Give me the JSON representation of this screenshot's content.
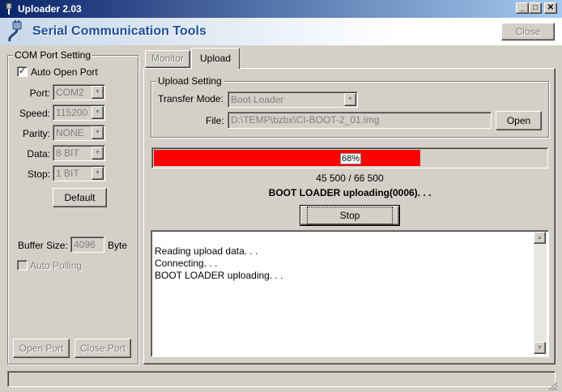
{
  "window": {
    "title": "Uploader 2.03",
    "minimize_icon": "_",
    "maximize_icon": "□",
    "close_icon": "✕"
  },
  "banner": {
    "text": "Serial Communication Tools",
    "close_label": "Close"
  },
  "com_port": {
    "group_label": "COM Port Setting",
    "auto_open_label": "Auto Open Port",
    "auto_open_checked": true,
    "fields": [
      {
        "label": "Port:",
        "value": "COM2"
      },
      {
        "label": "Speed:",
        "value": "115200"
      },
      {
        "label": "Parity:",
        "value": "NONE"
      },
      {
        "label": "Data:",
        "value": "8 BIT"
      },
      {
        "label": "Stop:",
        "value": "1 BIT"
      }
    ],
    "default_label": "Default",
    "buffer_label": "Buffer Size:",
    "buffer_value": "4096",
    "buffer_unit": "Byte",
    "auto_polling_label": "Auto Polling",
    "open_port_label": "Open Port",
    "close_port_label": "Close Port"
  },
  "tabs": [
    {
      "label": "Monitor",
      "active": false
    },
    {
      "label": "Upload",
      "active": true
    }
  ],
  "upload": {
    "group_label": "Upload Setting",
    "transfer_mode_label": "Transfer Mode:",
    "transfer_mode_value": "Boot Loader",
    "file_label": "File:",
    "file_value": "D:\\TEMP\\bzbx\\CI-BOOT-2_01.img",
    "open_label": "Open",
    "progress_fraction": 0.68,
    "progress_text": "68%",
    "bytes_text": "45 500 / 66 500",
    "status_text": "BOOT LOADER uploading(0006). . .",
    "stop_label": "Stop",
    "log_lines": [
      "Reading upload data. . .",
      "Connecting. . .",
      "BOOT LOADER uploading. . ."
    ]
  },
  "icons": {
    "app": "plug-icon",
    "checkbox": "✓",
    "dropdown": "▼",
    "scroll_up": "▲",
    "scroll_down": "▼"
  },
  "colors": {
    "progress": "#ff0000",
    "titlebar": "#0a246a",
    "banner_text": "#1f4e9a"
  }
}
